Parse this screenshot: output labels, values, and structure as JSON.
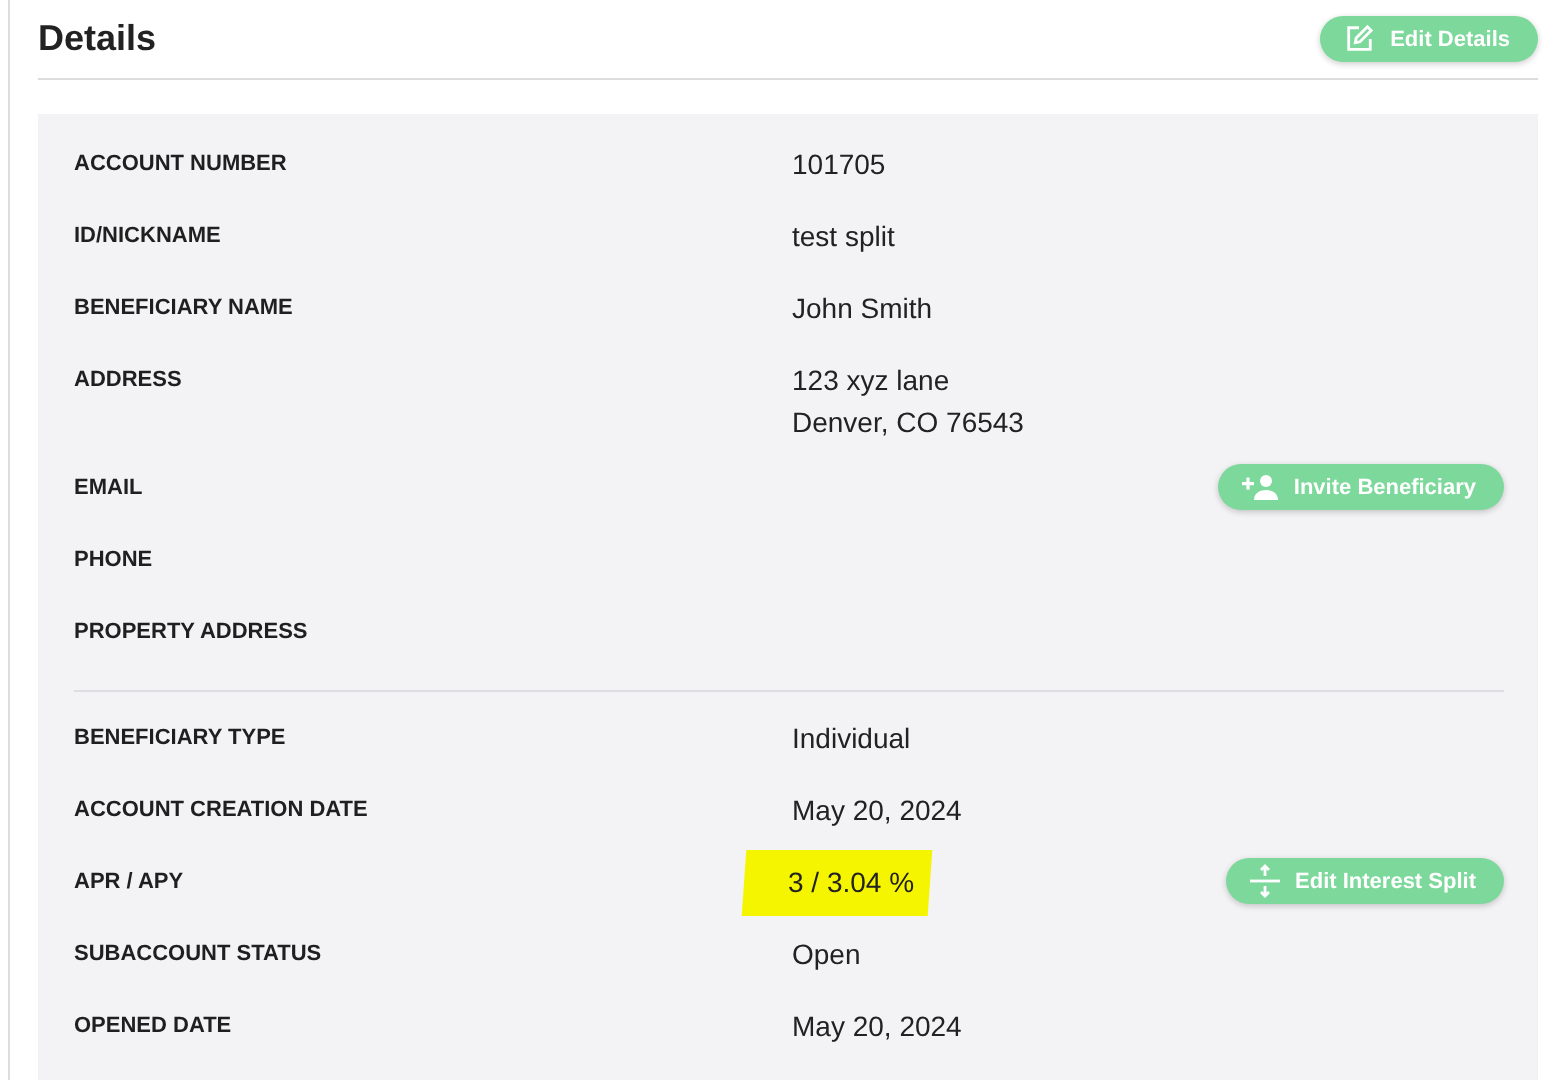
{
  "header": {
    "title": "Details",
    "button": {
      "label": "Edit Details",
      "kind": "edit"
    }
  },
  "sections": [
    {
      "rows": [
        {
          "label": "ACCOUNT NUMBER",
          "value": [
            "101705"
          ]
        },
        {
          "label": "ID/NICKNAME",
          "value": [
            "test split"
          ]
        },
        {
          "label": "BENEFICIARY NAME",
          "value": [
            "John Smith"
          ]
        },
        {
          "label": "ADDRESS",
          "value": [
            "123 xyz lane",
            "Denver, CO 76543"
          ]
        },
        {
          "label": "EMAIL",
          "button": {
            "label": "Invite Beneficiary",
            "kind": "add-person"
          }
        },
        {
          "label": "PHONE"
        },
        {
          "label": "PROPERTY ADDRESS"
        }
      ]
    },
    {
      "rows": [
        {
          "label": "BENEFICIARY TYPE",
          "value": [
            "Individual"
          ]
        },
        {
          "label": "ACCOUNT CREATION DATE",
          "value": [
            "May 20, 2024"
          ]
        },
        {
          "label": "APR / APY",
          "value": [
            "3 / 3.04 %"
          ],
          "highlighted": true,
          "button": {
            "label": "Edit Interest Split",
            "kind": "split"
          }
        },
        {
          "label": "SUBACCOUNT STATUS",
          "value": [
            "Open"
          ]
        },
        {
          "label": "OPENED DATE",
          "value": [
            "May 20, 2024"
          ]
        }
      ]
    }
  ]
}
